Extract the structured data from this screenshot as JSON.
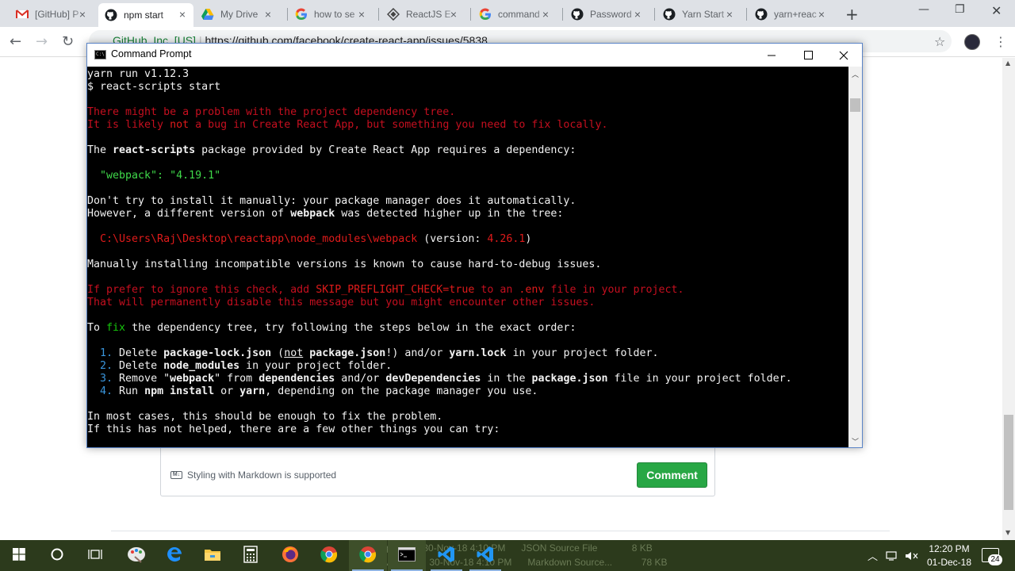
{
  "browser": {
    "tabs": [
      {
        "label": "[GitHub] P",
        "icon": "gmail-icon"
      },
      {
        "label": "npm start",
        "icon": "github-icon",
        "active": true
      },
      {
        "label": "My Drive",
        "icon": "google-drive-icon"
      },
      {
        "label": "how to se",
        "icon": "google-icon"
      },
      {
        "label": "ReactJS E",
        "icon": "reactjs-icon"
      },
      {
        "label": "command",
        "icon": "google-icon"
      },
      {
        "label": "Password",
        "icon": "github-icon"
      },
      {
        "label": "Yarn Start",
        "icon": "github-icon"
      },
      {
        "label": "yarn+reac",
        "icon": "github-icon"
      }
    ],
    "address": {
      "security_label": "GitHub, Inc. [US]",
      "url": "https://github.com/facebook/create-react-app/issues/5838"
    }
  },
  "github": {
    "markdown_note": "Styling with Markdown is supported",
    "comment_button": "Comment"
  },
  "cmd": {
    "title": "Command Prompt",
    "lines": {
      "l1": "yarn run v1.12.3",
      "l2": "$ react-scripts start",
      "l3": "There might be a problem with the project dependency tree.",
      "l4a": "It is likely ",
      "l4b": "not",
      "l4c": " a bug in Create React App, but something you need to fix locally.",
      "l5a": "The ",
      "l5b": "react-scripts",
      "l5c": " package provided by Create React App requires a dependency:",
      "l6": "  \"webpack\": \"4.19.1\"",
      "l7": "Don't try to install it manually: your package manager does it automatically.",
      "l8a": "However, a different version of ",
      "l8b": "webpack",
      "l8c": " was detected higher up in the tree:",
      "l9a": "  C:\\Users\\Raj\\Desktop\\reactapp\\node_modules\\webpack",
      "l9b": " (version: ",
      "l9c": "4.26.1",
      "l9d": ")",
      "l10": "Manually installing incompatible versions is known to cause hard-to-debug issues.",
      "l11a": "If prefer to ignore this check, add ",
      "l11b": "SKIP_PREFLIGHT_CHECK=true",
      "l11c": " to an ",
      "l11d": ".env",
      "l11e": " file in your project.",
      "l12": "That will permanently disable this message but you might encounter other issues.",
      "l13a": "To ",
      "l13b": "fix",
      "l13c": " the dependency tree, try following the steps below in the exact order:",
      "s1n": "  1.",
      "s1a": " Delete ",
      "s1b": "package-lock.json",
      "s1c": " (",
      "s1d": "not",
      "s1e": " ",
      "s1f": "package.json",
      "s1g": "!) and/or ",
      "s1h": "yarn.lock",
      "s1i": " in your project folder.",
      "s2n": "  2.",
      "s2a": " Delete ",
      "s2b": "node_modules",
      "s2c": " in your project folder.",
      "s3n": "  3.",
      "s3a": " Remove \"",
      "s3b": "webpack",
      "s3c": "\" from ",
      "s3d": "dependencies",
      "s3e": " and/or ",
      "s3f": "devDependencies",
      "s3g": " in the ",
      "s3h": "package.json",
      "s3i": " file in your project folder.",
      "s4n": "  4.",
      "s4a": " Run ",
      "s4b": "npm install",
      "s4c": " or ",
      "s4d": "yarn",
      "s4e": ", depending on the package manager you use.",
      "l14": "In most cases, this should be enough to fix the problem.",
      "l15": "If this has not helped, there are a few other things you can try:"
    }
  },
  "taskbar": {
    "ghost_row1": "Package...        30-Nov-18 4:10 PM      JSON Source File             8 KB",
    "ghost_row2": "README...         30-Nov-18 4:10 PM      Markdown Source...           78 KB",
    "time": "12:20 PM",
    "date": "01-Dec-18",
    "notification_count": "24"
  }
}
